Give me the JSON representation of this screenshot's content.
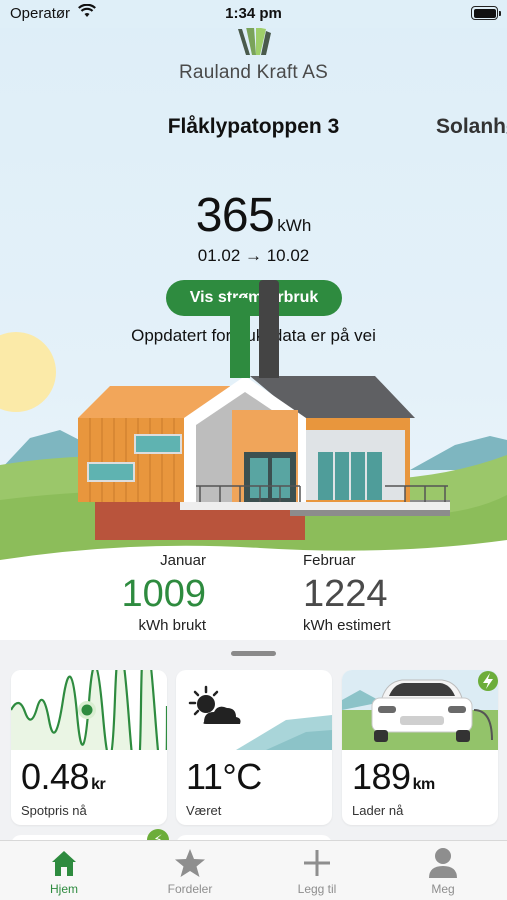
{
  "status_bar": {
    "carrier": "Operatør",
    "time": "1:34 pm"
  },
  "brand": {
    "name": "Rauland Kraft AS"
  },
  "locations": {
    "active": "Flåklypatoppen 3",
    "next": "Solanhø"
  },
  "usage": {
    "value": "365",
    "unit": "kWh",
    "period": "01.02 → 10.02",
    "button_label": "Vis strømforbruk",
    "update_note": "Oppdatert forbruksdata er på vei"
  },
  "comparison": {
    "current": {
      "month": "Januar",
      "value": "1009",
      "sublabel": "kWh brukt",
      "bar_fraction": 0.82
    },
    "estimate": {
      "month": "Februar",
      "value": "1224",
      "sublabel": "kWh estimert",
      "bar_fraction": 1.0
    }
  },
  "cards": [
    {
      "value": "0.48",
      "unit": "kr",
      "label": "Spotpris nå",
      "icon": "price-wave-icon"
    },
    {
      "value": "11°C",
      "unit": "",
      "label": "Været",
      "icon": "partly-cloudy-icon"
    },
    {
      "value": "189",
      "unit": "km",
      "label": "Lader nå",
      "icon": "electric-car-icon"
    }
  ],
  "tabs": [
    {
      "label": "Hjem",
      "icon": "home-icon"
    },
    {
      "label": "Fordeler",
      "icon": "star-icon"
    },
    {
      "label": "Legg til",
      "icon": "plus-icon"
    },
    {
      "label": "Meg",
      "icon": "person-icon"
    }
  ],
  "colors": {
    "accent": "#2e8b3f",
    "estimate_bar": "#444444",
    "charging_badge": "#6cad3a"
  }
}
